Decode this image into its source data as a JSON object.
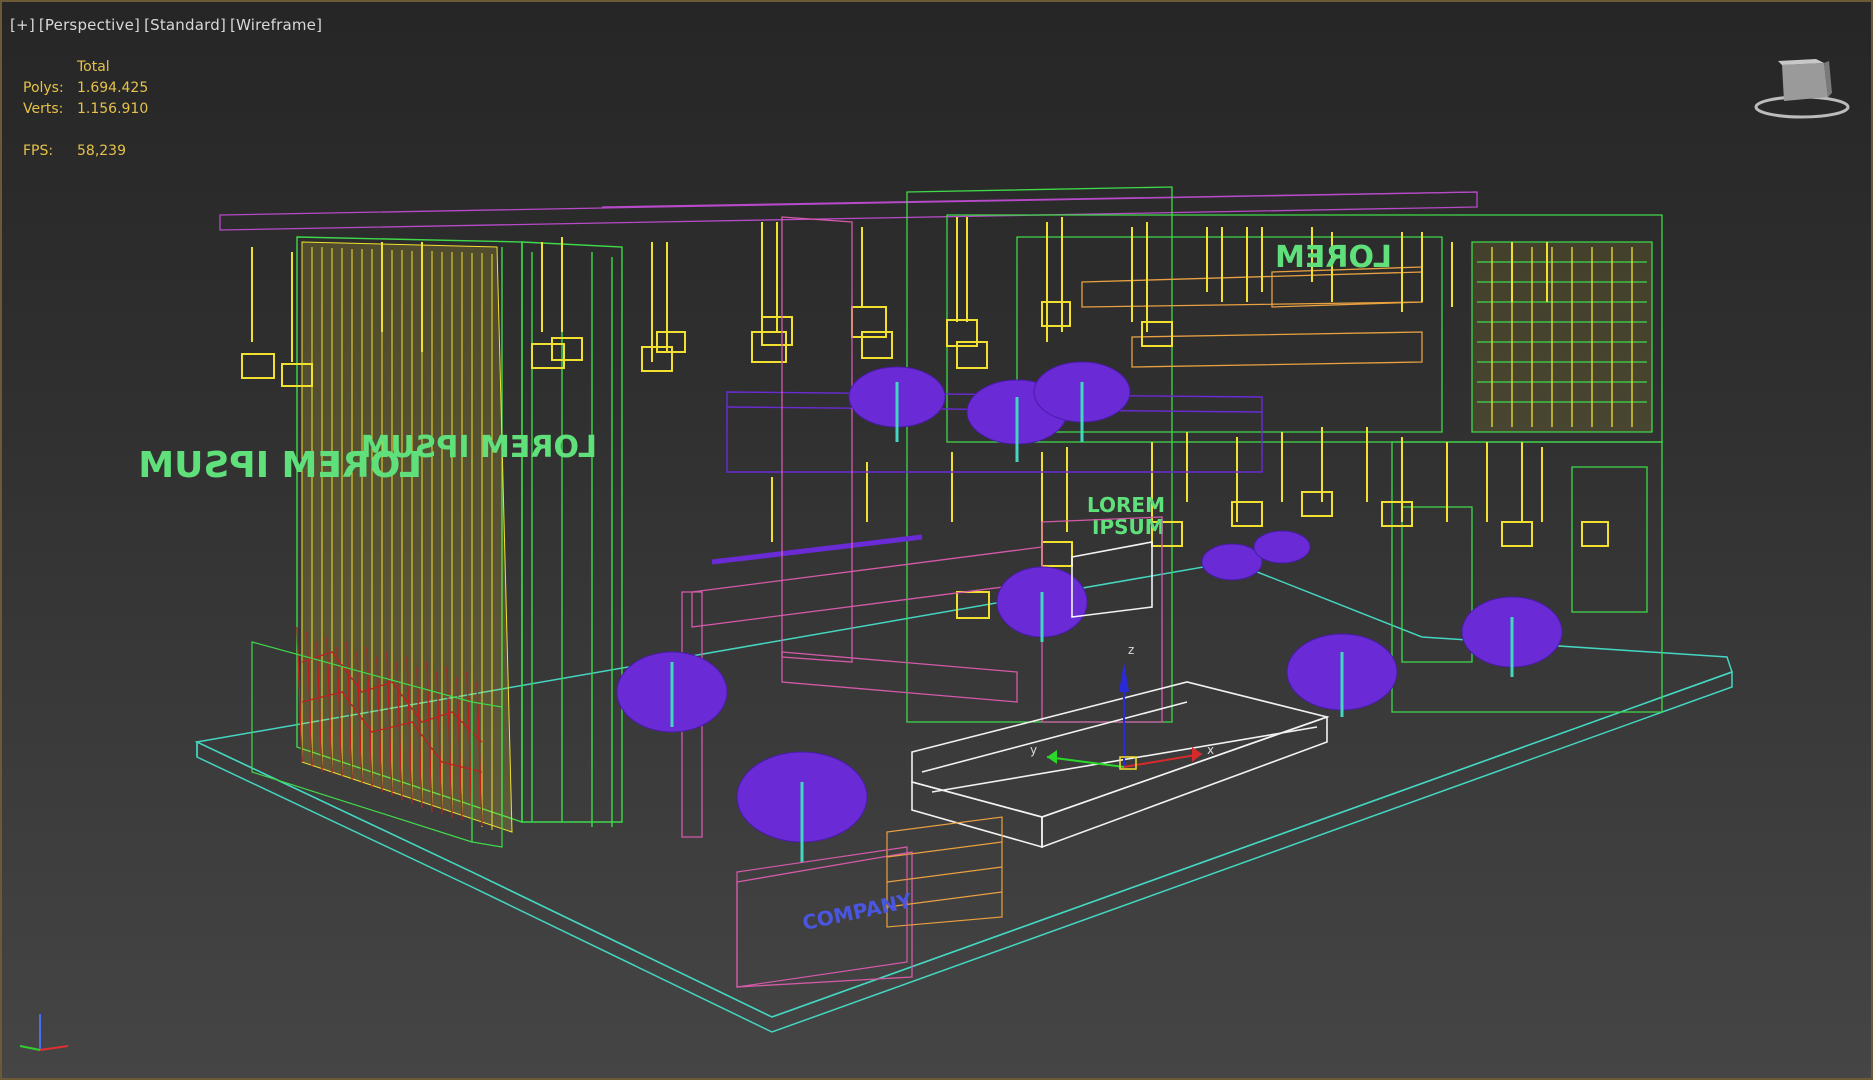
{
  "viewport": {
    "label_plus": "[+]",
    "label_view": "[Perspective]",
    "label_shading_1": "[Standard]",
    "label_shading_2": "[Wireframe]"
  },
  "stats": {
    "header": "Total",
    "polys_label": "Polys:",
    "polys_value": "1.694.425",
    "verts_label": "Verts:",
    "verts_value": "1.156.910",
    "fps_label": "FPS:",
    "fps_value": "58,239"
  },
  "scene_text": {
    "lorem_ipsum_mirrored": "LOREM IPSUM",
    "company": "COMPANY",
    "lorem_small": "LOREM",
    "ipsum_small": "IPSUM",
    "lorem_top": "LOREM",
    "gizmo_x": "x",
    "gizmo_y": "y",
    "gizmo_z": "z"
  },
  "colors": {
    "wire_green": "#3fd94a",
    "wire_yellow": "#f2e030",
    "wire_purple": "#6a2bd6",
    "wire_teal": "#44d6c0",
    "wire_pink": "#d45aa8",
    "wire_red": "#c21e1e",
    "wire_white": "#f2f2f2",
    "stats_text": "#e6c24a"
  },
  "icons": {
    "viewcube": "viewcube-icon",
    "axis_tripod": "axis-tripod-icon"
  }
}
